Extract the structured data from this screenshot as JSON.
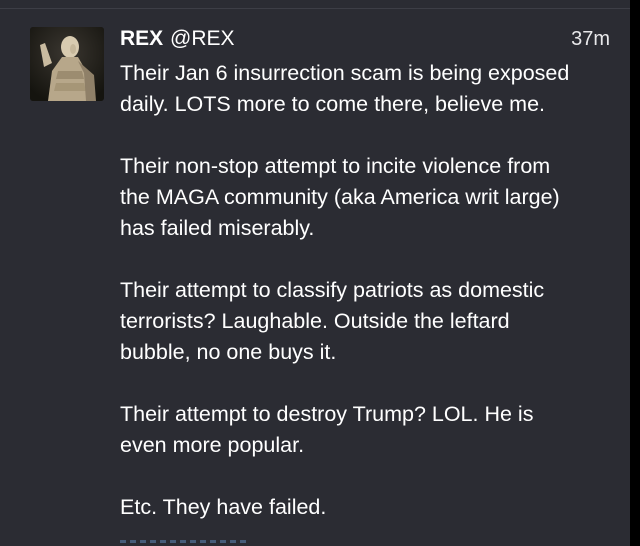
{
  "post": {
    "author_name": "REX",
    "author_handle": "@REX",
    "timestamp": "37m",
    "avatar_icon": "roman-statue-avatar-icon",
    "paragraphs": [
      "Their Jan 6 insurrection scam is being exposed\ndaily. LOTS more to come there, believe me.",
      "Their non-stop attempt to incite violence from\nthe MAGA community (aka America writ large)\nhas failed miserably.",
      "Their attempt to classify patriots as domestic\nterrorists? Laughable. Outside the leftard\nbubble, no one buys it.",
      "Their attempt to destroy Trump? LOL. He is\neven more popular.",
      "Etc. They have failed."
    ]
  },
  "colors": {
    "background": "#2b2c33",
    "text": "#ffffff",
    "divider": "#3d3e46"
  }
}
